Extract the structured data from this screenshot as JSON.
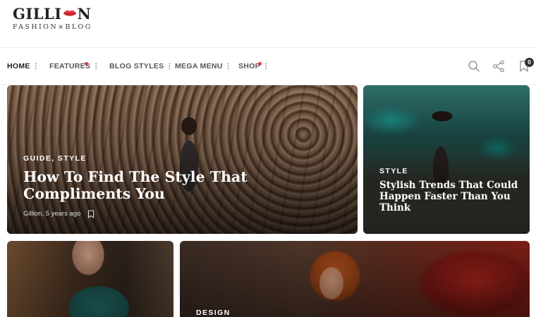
{
  "brand": {
    "name_left": "GILLI",
    "name_right": "N",
    "tagline": "FASHION×BLOG",
    "accent_color": "#e5343d"
  },
  "nav": {
    "items": [
      {
        "label": "HOME",
        "active": true,
        "dot": false
      },
      {
        "label": "FEATURES",
        "active": false,
        "dot": true
      },
      {
        "label": "BLOG STYLES",
        "active": false,
        "dot": false
      },
      {
        "label": "MEGA MENU",
        "active": false,
        "dot": false
      },
      {
        "label": "SHOP",
        "active": false,
        "dot": true
      }
    ],
    "dots_glyph": "⋮",
    "icons": [
      "search-icon",
      "share-icon",
      "cart-icon"
    ],
    "cart_count": "0"
  },
  "posts": [
    {
      "category": "GUIDE, STYLE",
      "title": "How To Find The Style That Compliments You",
      "author": "Gillion",
      "age": "5 years ago",
      "meta": "Gillion, 5 years ago"
    },
    {
      "category": "STYLE",
      "title": "Stylish Trends That Could Happen Faster Than You Think"
    },
    {
      "category": "",
      "title": ""
    },
    {
      "category": "DESIGN",
      "title": ""
    }
  ]
}
